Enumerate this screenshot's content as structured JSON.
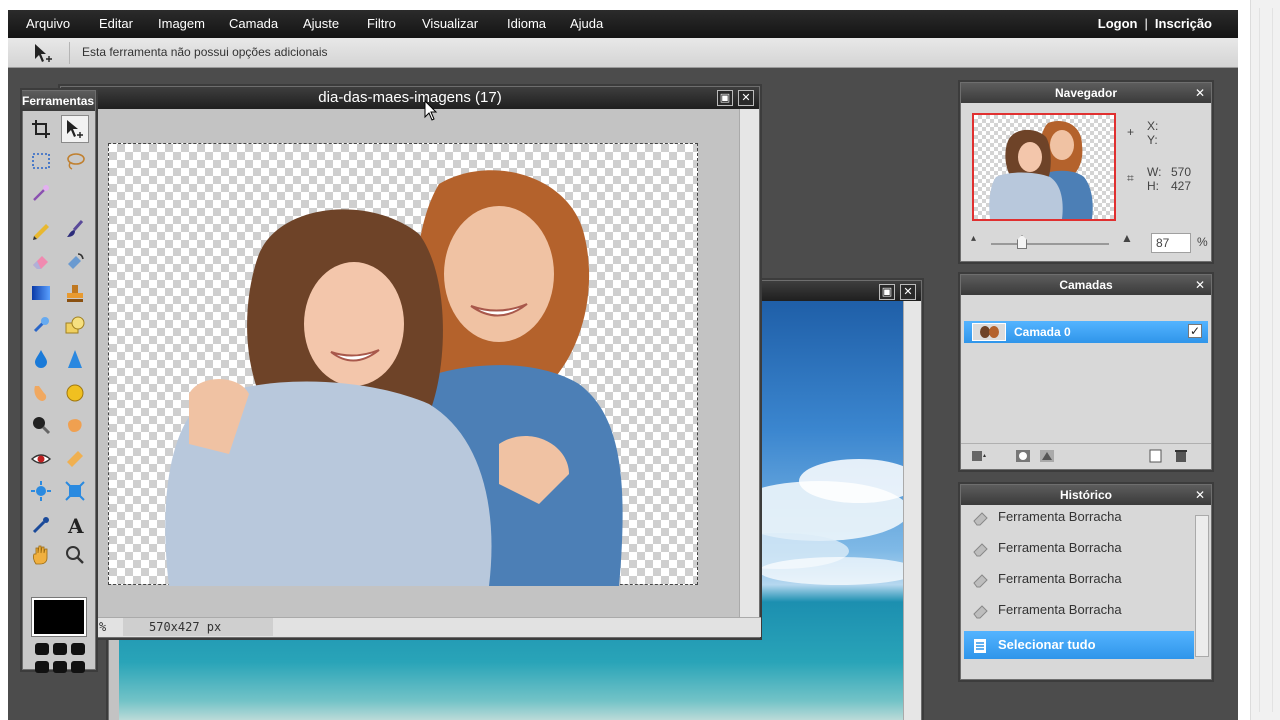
{
  "menu": {
    "items": [
      "Arquivo",
      "Editar",
      "Imagem",
      "Camada",
      "Ajuste",
      "Filtro",
      "Visualizar",
      "Idioma",
      "Ajuda"
    ],
    "logon": "Logon",
    "separator": "|",
    "signup": "Inscrição"
  },
  "options_bar": {
    "tool_icon": "move-tool-icon",
    "message": "Esta ferramenta não possui opções adicionais"
  },
  "tools_panel": {
    "title": "Ferramentas",
    "active_tool": "move-tool",
    "foreground_color": "#000000"
  },
  "document_main": {
    "title": "dia-das-maes-imagens (17)",
    "zoom_suffix": "%",
    "size_text": "570x427 px"
  },
  "navigator": {
    "title": "Navegador",
    "x_label": "X:",
    "y_label": "Y:",
    "w_label": "W:",
    "w_value": "570",
    "h_label": "H:",
    "h_value": "427",
    "zoom_value": "87",
    "zoom_unit": "%"
  },
  "layers": {
    "title": "Camadas",
    "items": [
      {
        "name": "Camada 0",
        "visible": true
      }
    ]
  },
  "history": {
    "title": "Histórico",
    "items": [
      {
        "label": "Ferramenta Borracha",
        "icon": "eraser-icon",
        "selected": false
      },
      {
        "label": "Ferramenta Borracha",
        "icon": "eraser-icon",
        "selected": false
      },
      {
        "label": "Ferramenta Borracha",
        "icon": "eraser-icon",
        "selected": false
      },
      {
        "label": "Ferramenta Borracha",
        "icon": "eraser-icon",
        "selected": false
      },
      {
        "label": "Selecionar tudo",
        "icon": "select-all-icon",
        "selected": true
      }
    ]
  },
  "colors": {
    "menubar": "#1c1c1c",
    "workspace": "#4c4c4c",
    "selection_blue": "#3a9df0",
    "navigator_frame": "#e03030"
  }
}
